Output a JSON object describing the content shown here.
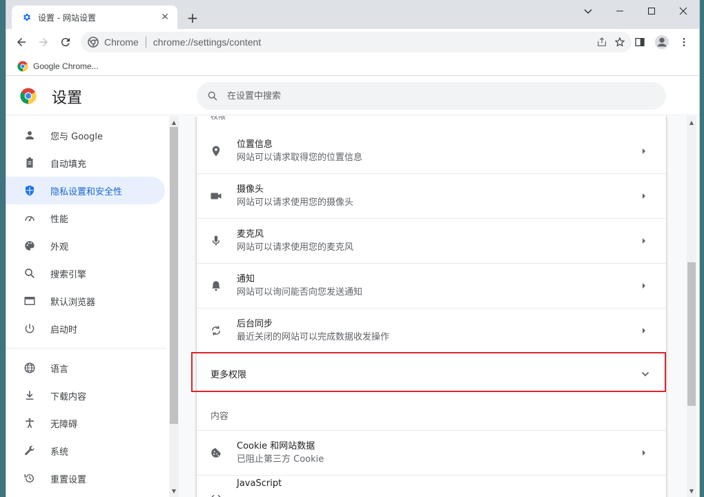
{
  "tab": {
    "title": "设置 - 网站设置",
    "close": "✕",
    "new_tab": "+"
  },
  "window_controls": [
    "chevron-down",
    "minimize",
    "maximize",
    "close"
  ],
  "toolbar": {
    "site_name": "Chrome",
    "url": "chrome://settings/content"
  },
  "bookmarks": [
    {
      "label": "Google Chrome..."
    }
  ],
  "header": {
    "title": "设置",
    "search_placeholder": "在设置中搜索"
  },
  "sidebar": {
    "items": [
      {
        "label": "您与 Google",
        "icon": "person-icon",
        "active": false
      },
      {
        "label": "自动填充",
        "icon": "clipboard-icon",
        "active": false
      },
      {
        "label": "隐私设置和安全性",
        "icon": "shield-icon",
        "active": true
      },
      {
        "label": "性能",
        "icon": "speedometer-icon",
        "active": false
      },
      {
        "label": "外观",
        "icon": "palette-icon",
        "active": false
      },
      {
        "label": "搜索引擎",
        "icon": "search-icon",
        "active": false
      },
      {
        "label": "默认浏览器",
        "icon": "browser-icon",
        "active": false
      },
      {
        "label": "启动时",
        "icon": "power-icon",
        "active": false
      },
      {
        "label": "语言",
        "icon": "globe-icon",
        "active": false
      },
      {
        "label": "下载内容",
        "icon": "download-icon",
        "active": false
      },
      {
        "label": "无障碍",
        "icon": "accessibility-icon",
        "active": false
      },
      {
        "label": "系统",
        "icon": "wrench-icon",
        "active": false
      },
      {
        "label": "重置设置",
        "icon": "reset-icon",
        "active": false
      }
    ]
  },
  "main": {
    "partial_heading": "权限",
    "permissions": [
      {
        "title": "位置信息",
        "subtitle": "网站可以请求取得您的位置信息",
        "icon": "location-icon"
      },
      {
        "title": "摄像头",
        "subtitle": "网站可以请求使用您的摄像头",
        "icon": "camera-icon"
      },
      {
        "title": "麦克风",
        "subtitle": "网站可以请求使用您的麦克风",
        "icon": "microphone-icon"
      },
      {
        "title": "通知",
        "subtitle": "网站可以询问能否向您发送通知",
        "icon": "bell-icon"
      },
      {
        "title": "后台同步",
        "subtitle": "最近关闭的网站可以完成数据收发操作",
        "icon": "sync-icon"
      }
    ],
    "more_permissions": "更多权限",
    "content_section_label": "内容",
    "content_items": [
      {
        "title": "Cookie 和网站数据",
        "subtitle": "已阻止第三方 Cookie",
        "icon": "cookie-icon"
      },
      {
        "title": "JavaScript",
        "subtitle": "",
        "icon": "code-icon"
      }
    ]
  },
  "colors": {
    "accent": "#1a73e8",
    "highlight_box": "#d9252c",
    "active_nav_bg": "#e8f0fe"
  }
}
